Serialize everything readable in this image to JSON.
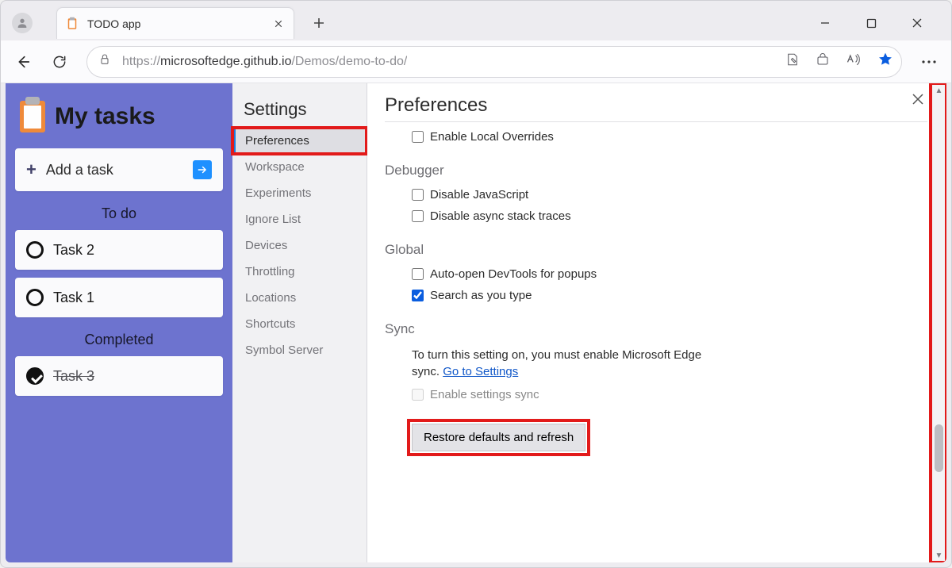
{
  "browser": {
    "tab_title": "TODO app",
    "url_prefix": "https://",
    "url_host": "microsoftedge.github.io",
    "url_path": "/Demos/demo-to-do/"
  },
  "app": {
    "title": "My tasks",
    "add_label": "Add a task",
    "sections": {
      "todo": {
        "heading": "To do",
        "items": [
          "Task 2",
          "Task 1"
        ]
      },
      "completed": {
        "heading": "Completed",
        "items": [
          "Task 3"
        ]
      }
    }
  },
  "settings": {
    "title": "Settings",
    "nav": [
      "Preferences",
      "Workspace",
      "Experiments",
      "Ignore List",
      "Devices",
      "Throttling",
      "Locations",
      "Shortcuts",
      "Symbol Server"
    ],
    "active_index": 0
  },
  "prefs": {
    "title": "Preferences",
    "top_option": {
      "label": "Enable Local Overrides",
      "checked": false
    },
    "debugger": {
      "heading": "Debugger",
      "opts": [
        {
          "label": "Disable JavaScript",
          "checked": false
        },
        {
          "label": "Disable async stack traces",
          "checked": false
        }
      ]
    },
    "global": {
      "heading": "Global",
      "opts": [
        {
          "label": "Auto-open DevTools for popups",
          "checked": false
        },
        {
          "label": "Search as you type",
          "checked": true
        }
      ]
    },
    "sync": {
      "heading": "Sync",
      "message_pre": "To turn this setting on, you must enable Microsoft Edge sync. ",
      "link": "Go to Settings",
      "opt": {
        "label": "Enable settings sync",
        "checked": false,
        "disabled": true
      }
    },
    "restore": "Restore defaults and refresh"
  }
}
